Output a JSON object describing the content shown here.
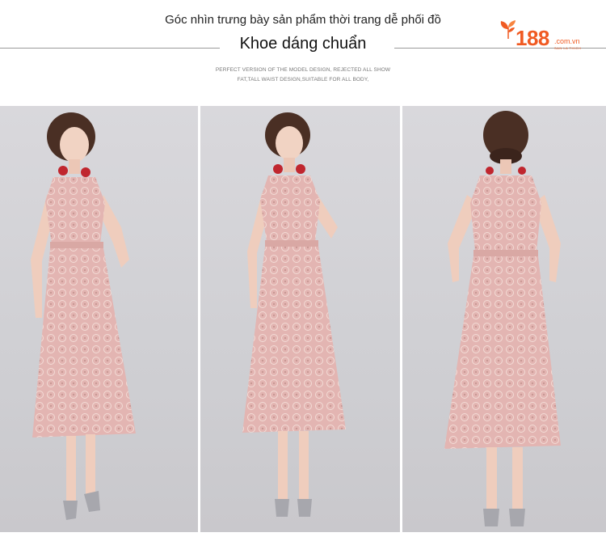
{
  "header": {
    "caption": "Góc nhìn trưng bày sản phẩm thời trang dễ phối đồ",
    "headline": "Khoe dáng chuẩn",
    "sub_line1": "PERFECT VERSION OF THE MODEL DESIGN, REJECTED ALL SHOW",
    "sub_line2": "FAT,TALL WAIST DESIGN,SUITABLE FOR ALL BODY,"
  },
  "logo": {
    "number": "188",
    "domain": ".com.vn",
    "tagline": "SAN LA THICH",
    "color": "#f05a22",
    "icon": "leaf-sprout-icon"
  },
  "photos": [
    {
      "view": "front-left-pose"
    },
    {
      "view": "front-pose"
    },
    {
      "view": "back-view"
    }
  ],
  "colors": {
    "dress": "#e6b9b6",
    "background": "#d6d5d9"
  }
}
